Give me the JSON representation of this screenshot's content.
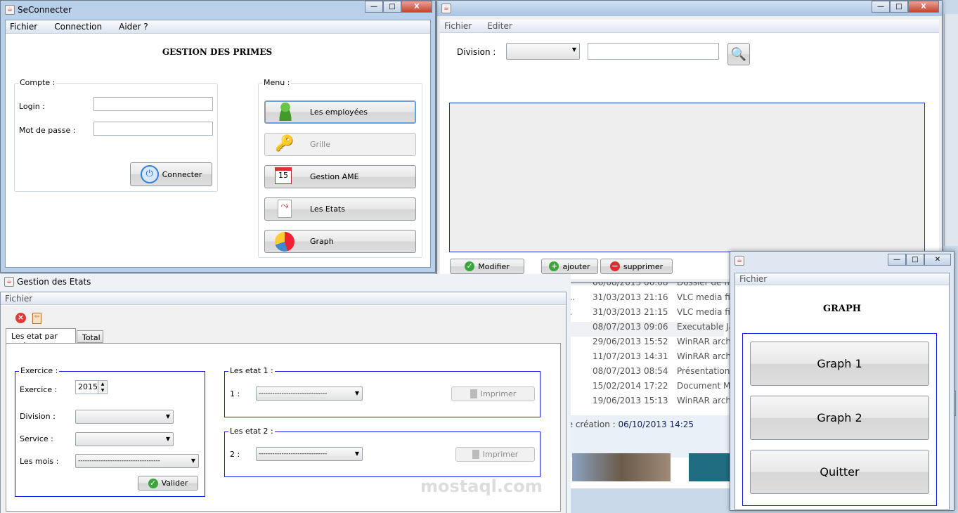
{
  "background": {
    "rows": [
      {
        "date": "06/08/2013 06:08",
        "type": "Dossier de fichi"
      },
      {
        "prefix": "w...",
        "date": "31/03/2013 21:16",
        "type": "VLC media file"
      },
      {
        "prefix": "t...",
        "date": "31/03/2013 21:15",
        "type": "VLC media file"
      },
      {
        "date": "08/07/2013 09:06",
        "type": "Executable Jar"
      },
      {
        "date": "29/06/2013 15:52",
        "type": "WinRAR archiv"
      },
      {
        "date": "11/07/2013 14:31",
        "type": "WinRAR archiv"
      },
      {
        "date": "08/07/2013 08:54",
        "type": "Présentation M"
      },
      {
        "date": "15/02/2014 17:22",
        "type": "Document Mi"
      },
      {
        "date": "19/06/2013 15:13",
        "type": "WinRAR archiv"
      }
    ],
    "created_label": "de création :",
    "created_value": "06/10/2013 14:25"
  },
  "login_window": {
    "title": "SeConnecter",
    "menu": [
      "Fichier",
      "Connection",
      "Aider ?"
    ],
    "heading": "GESTION DES PRIMES",
    "compte": {
      "legend": "Compte :",
      "login_label": "Login :",
      "login_value": "",
      "password_label": "Mot de passe :",
      "password_value": "",
      "connect_button": "Connecter"
    },
    "menu_panel": {
      "legend": "Menu :",
      "buttons": [
        {
          "label": "Les employées",
          "icon": "user-icon"
        },
        {
          "label": "Grille",
          "icon": "key-icon",
          "disabled": true
        },
        {
          "label": "Gestion AME",
          "icon": "calendar-add-icon"
        },
        {
          "label": "Les Etats",
          "icon": "pdf-icon"
        },
        {
          "label": "Graph",
          "icon": "pie-chart-icon"
        }
      ]
    }
  },
  "division_window": {
    "menu": [
      "Fichier",
      "Editer"
    ],
    "division_label": "Division :",
    "division_value": "",
    "search_value": "",
    "buttons": {
      "modify": "Modifier",
      "add": "ajouter",
      "delete": "supprimer"
    }
  },
  "etats_window": {
    "title": "Gestion des Etats",
    "menu": [
      "Fichier"
    ],
    "tabs": [
      "Les etat par mois",
      "Total"
    ],
    "active_tab": "Les etat par mois",
    "exercice": {
      "legend": "Exercice :",
      "exercice_label": "Exercice :",
      "exercice_value": "2015",
      "division_label": "Division :",
      "service_label": "Service :",
      "mois_label": "Les mois :",
      "mois_value": "------------------------------------",
      "validate": "Valider"
    },
    "etat1": {
      "legend": "Les etat 1 :",
      "label": "1 :",
      "value": "------------------------------",
      "print": "Imprimer"
    },
    "etat2": {
      "legend": "Les etat 2 :",
      "label": "2 :",
      "value": "------------------------------",
      "print": "Imprimer"
    }
  },
  "graph_window": {
    "menu": [
      "Fichier"
    ],
    "heading": "GRAPH",
    "buttons": [
      "Graph 1",
      "Graph 2",
      "Quitter"
    ]
  },
  "watermark": {
    "text": "mostaql.com"
  }
}
